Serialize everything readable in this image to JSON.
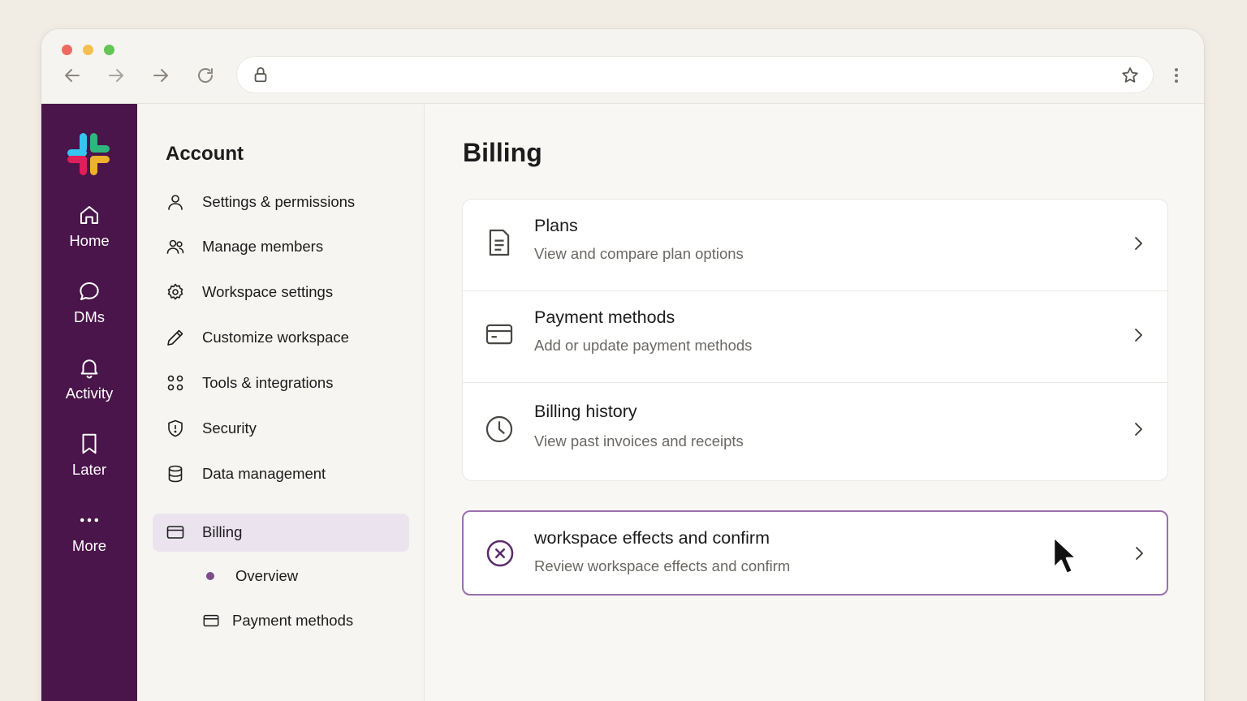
{
  "browser": {
    "url": "",
    "icons": [
      "back-icon",
      "forward-icon",
      "forward-icon",
      "reload-icon",
      "lock-icon",
      "star-icon",
      "kebab-icon"
    ]
  },
  "rail": {
    "items": [
      {
        "label": "Home",
        "icon": "home-icon"
      },
      {
        "label": "DMs",
        "icon": "chat-icon"
      },
      {
        "label": "Activity",
        "icon": "bell-icon"
      },
      {
        "label": "Later",
        "icon": "bookmark-icon"
      },
      {
        "label": "More",
        "icon": "more-icon"
      }
    ]
  },
  "sidebar": {
    "title": "Account",
    "items": [
      {
        "label": "Settings & permissions",
        "icon": "user-icon"
      },
      {
        "label": "Manage members",
        "icon": "users-icon"
      },
      {
        "label": "Workspace settings",
        "icon": "gear-icon"
      },
      {
        "label": "Customize workspace",
        "icon": "pencil-icon"
      },
      {
        "label": "Tools & integrations",
        "icon": "grid-icon"
      },
      {
        "label": "Security",
        "icon": "shield-icon"
      },
      {
        "label": "Data management",
        "icon": "database-icon"
      },
      {
        "label": "Billing",
        "icon": "card-icon",
        "active": true
      }
    ],
    "sub_items": [
      {
        "label": "Overview"
      },
      {
        "label": "Payment methods"
      }
    ]
  },
  "main": {
    "title": "Billing",
    "options": [
      {
        "title": "Plans",
        "subtitle": "View and compare plan options",
        "icon": "document-icon"
      },
      {
        "title": "Payment methods",
        "subtitle": "Add or update payment methods",
        "icon": "card-icon"
      },
      {
        "title": "Billing history",
        "subtitle": "View past invoices and receipts",
        "icon": "clock-icon"
      },
      {
        "title": "workspace effects and confirm",
        "subtitle": "Review workspace effects and confirm",
        "icon": "x-circle-icon",
        "selected": true
      }
    ]
  },
  "colors": {
    "rail_bg": "#4a154b",
    "accent": "#9a6fae",
    "active_bg": "#ebe4ef",
    "page_bg": "#f1ece4"
  }
}
